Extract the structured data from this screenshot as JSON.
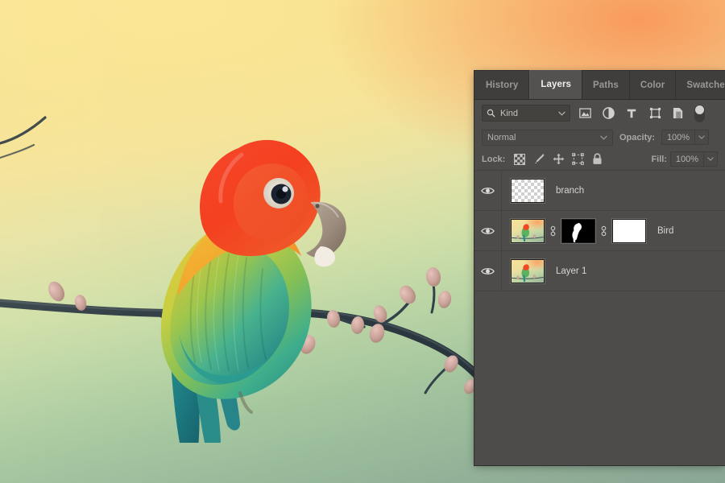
{
  "app": {
    "panel_title": "Layers"
  },
  "tabs": [
    {
      "label": "History",
      "active": false
    },
    {
      "label": "Layers",
      "active": true
    },
    {
      "label": "Paths",
      "active": false
    },
    {
      "label": "Color",
      "active": false
    },
    {
      "label": "Swatches",
      "active": false
    }
  ],
  "filter": {
    "search_icon": "search-icon",
    "kind_label": "Kind",
    "chevron": "chevron-down-icon",
    "type_filters": [
      {
        "name": "filter-pixel-layers-icon",
        "title": "Pixel layers"
      },
      {
        "name": "filter-adjustment-icon",
        "title": "Adjustment layers"
      },
      {
        "name": "filter-type-icon",
        "title": "Type layers"
      },
      {
        "name": "filter-shape-icon",
        "title": "Shape layers"
      },
      {
        "name": "filter-smart-object-icon",
        "title": "Smart objects"
      }
    ],
    "toggle_on": true
  },
  "blend": {
    "mode": "Normal",
    "mode_chevron": "chevron-down-icon",
    "opacity_label": "Opacity:",
    "opacity_value": "100%",
    "opacity_chevron": "chevron-down-icon"
  },
  "lock": {
    "label": "Lock:",
    "items": [
      {
        "name": "lock-transparent-pixels-icon",
        "title": "Lock transparent pixels"
      },
      {
        "name": "lock-image-pixels-icon",
        "title": "Lock image pixels"
      },
      {
        "name": "lock-position-icon",
        "title": "Lock position"
      },
      {
        "name": "lock-artboard-nesting-icon",
        "title": "Prevent auto-nesting"
      },
      {
        "name": "lock-all-icon",
        "title": "Lock all"
      }
    ],
    "fill_label": "Fill:",
    "fill_value": "100%",
    "fill_chevron": "chevron-down-icon"
  },
  "layers": [
    {
      "name": "branch",
      "visible": true,
      "thumbs": [
        {
          "kind": "transparent",
          "name": "layer-thumbnail"
        }
      ]
    },
    {
      "name": "Bird",
      "visible": true,
      "thumbs": [
        {
          "kind": "photo",
          "name": "layer-thumbnail"
        },
        {
          "kind": "link",
          "name": "mask-link-icon"
        },
        {
          "kind": "maskblack",
          "name": "layer-mask-thumbnail"
        },
        {
          "kind": "link",
          "name": "vector-mask-link-icon"
        },
        {
          "kind": "white",
          "name": "vector-mask-thumbnail"
        }
      ]
    },
    {
      "name": "Layer 1",
      "visible": true,
      "thumbs": [
        {
          "kind": "photo",
          "name": "layer-thumbnail"
        }
      ]
    }
  ],
  "colors": {
    "panel_bg": "#4d4c4a",
    "tab_bg": "#3f3e3c",
    "tab_active_bg": "#535250",
    "text": "#c9c7c4",
    "text_bright": "#f0efee",
    "canvas_top_left": "#f8e391",
    "canvas_top_right": "#f9a863",
    "canvas_bottom": "#8aa695"
  },
  "canvas": {
    "subject": "lovebird perched on a budding branch",
    "eye_icon": "eye-visible-icon"
  }
}
